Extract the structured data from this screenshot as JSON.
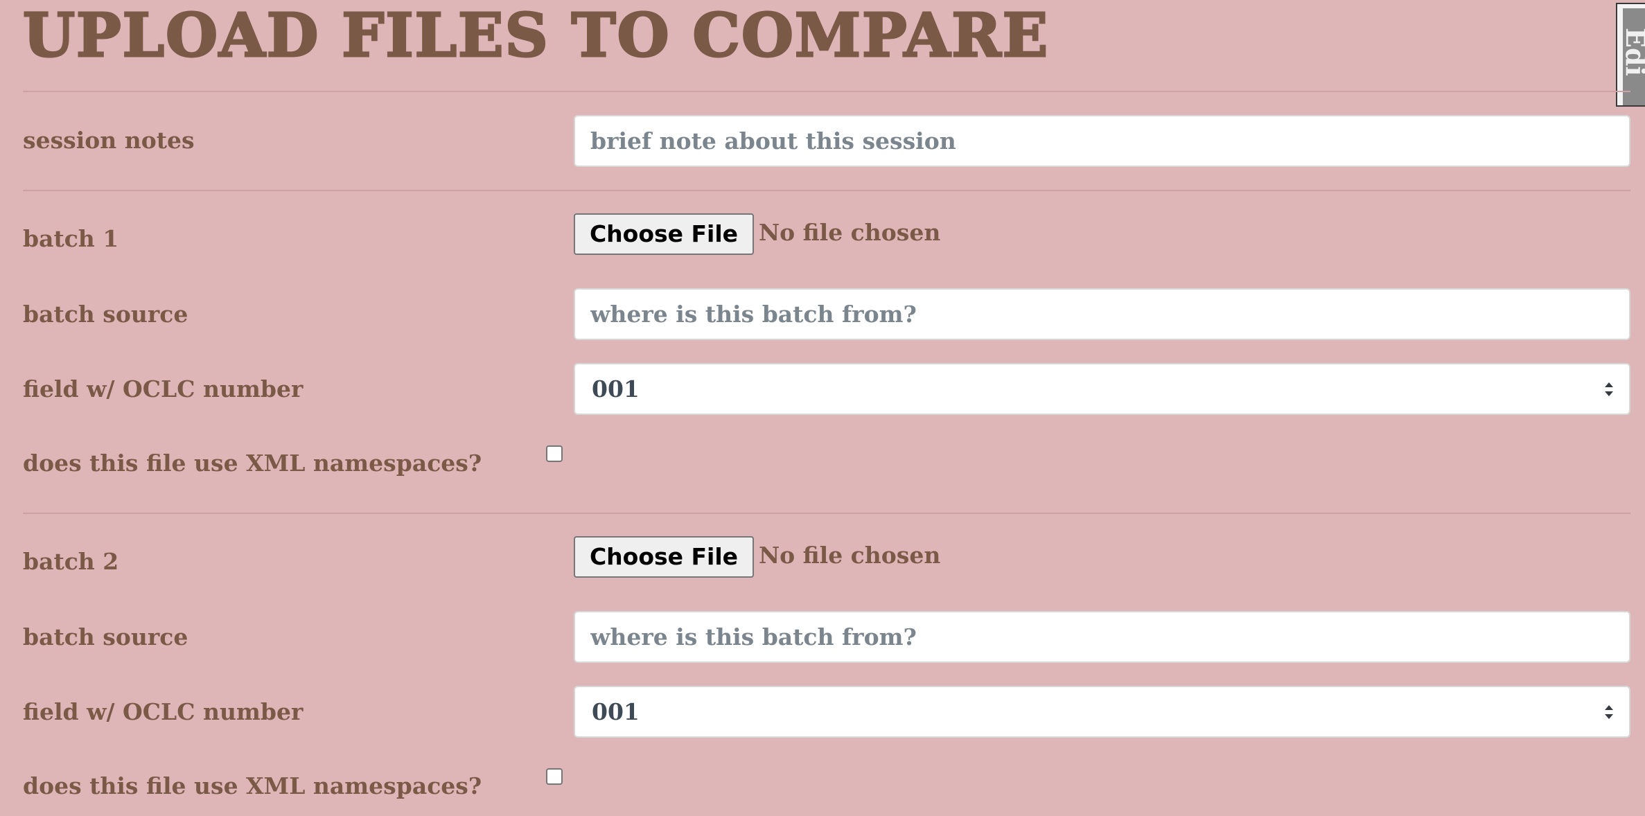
{
  "page_title": "UPLOAD FILES TO COMPARE",
  "edit_tab": {
    "label": "Edi"
  },
  "session": {
    "label": "session notes",
    "placeholder": "brief note about this session",
    "value": ""
  },
  "batches": [
    {
      "label": "batch 1",
      "file_button": "Choose File",
      "file_status": "No file chosen",
      "source_label": "batch source",
      "source_placeholder": "where is this batch from?",
      "oclc_label": "field w/ OCLC number",
      "oclc_value": "001",
      "xml_label": "does this file use XML namespaces?",
      "xml_checked": false
    },
    {
      "label": "batch 2",
      "file_button": "Choose File",
      "file_status": "No file chosen",
      "source_label": "batch source",
      "source_placeholder": "where is this batch from?",
      "oclc_label": "field w/ OCLC number",
      "oclc_value": "001",
      "xml_label": "does this file use XML namespaces?",
      "xml_checked": false
    }
  ],
  "colors": {
    "background": "#dfb6b8",
    "text": "#7a5a47",
    "divider": "#cfa1a3",
    "input_background": "#ffffff",
    "placeholder": "#7b858e"
  },
  "icons": {
    "select_arrows": "select-arrows-icon"
  }
}
